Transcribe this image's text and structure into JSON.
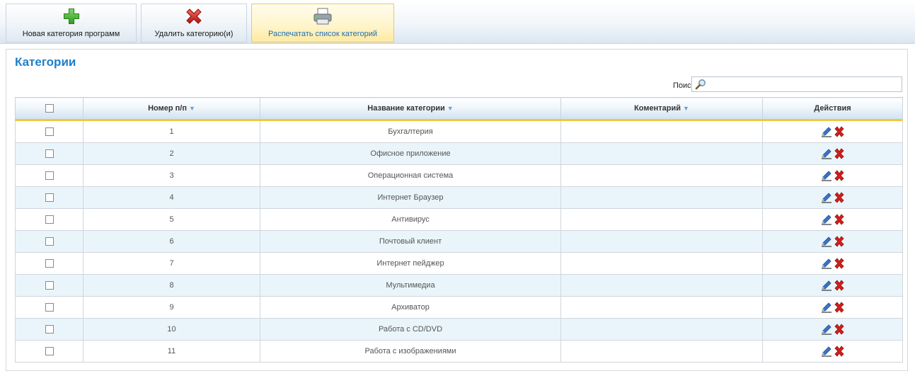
{
  "toolbar": {
    "new_category": "Новая категория программ",
    "delete_category": "Удалить категорию(и)",
    "print_list": "Распечатать список категорий"
  },
  "page": {
    "title": "Категории",
    "search_label": "Поиск:",
    "search_value": ""
  },
  "table": {
    "headers": {
      "number": "Номер п/п",
      "name": "Название категории",
      "comment": "Коментарий",
      "actions": "Действия"
    },
    "rows": [
      {
        "number": "1",
        "name": "Бухгалтерия",
        "comment": ""
      },
      {
        "number": "2",
        "name": "Офисное приложение",
        "comment": ""
      },
      {
        "number": "3",
        "name": "Операционная система",
        "comment": ""
      },
      {
        "number": "4",
        "name": "Интернет Браузер",
        "comment": ""
      },
      {
        "number": "5",
        "name": "Антивирус",
        "comment": ""
      },
      {
        "number": "6",
        "name": "Почтовый клиент",
        "comment": ""
      },
      {
        "number": "7",
        "name": "Интернет пейджер",
        "comment": ""
      },
      {
        "number": "8",
        "name": "Мультимедиа",
        "comment": ""
      },
      {
        "number": "9",
        "name": "Архиватор",
        "comment": ""
      },
      {
        "number": "10",
        "name": "Работа с CD/DVD",
        "comment": ""
      },
      {
        "number": "11",
        "name": "Работа с изображениями",
        "comment": ""
      }
    ]
  },
  "icons": {
    "add": "plus-icon",
    "delete": "close-icon",
    "print": "printer-icon",
    "search": "magnifier-icon",
    "sort": "sort-down-icon",
    "edit": "pencil-icon",
    "remove": "x-icon"
  },
  "colors": {
    "title": "#1e7ec8",
    "header_underline": "#f2c83b",
    "row_alt": "#eaf5fb",
    "add_green": "#3dae2b",
    "delete_red": "#d3201c"
  }
}
